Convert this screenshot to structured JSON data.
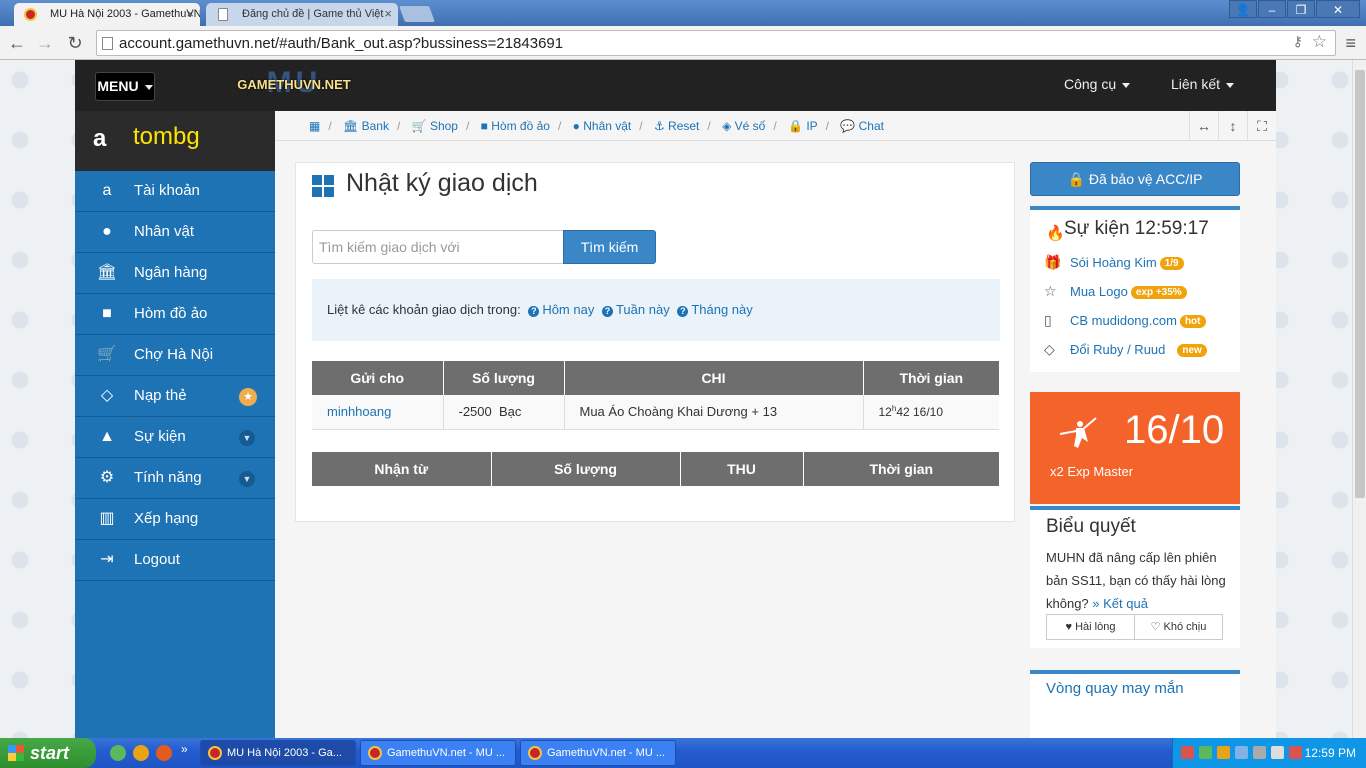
{
  "browser": {
    "tabs": [
      {
        "title": "MU Hà Nội 2003 - GamethuVN",
        "active": true
      },
      {
        "title": "Đăng chủ đề | Game thủ Việt",
        "active": false
      }
    ],
    "url": "account.gamethuvn.net/#auth/Bank_out.asp?bussiness=21843691"
  },
  "topnav": {
    "menu_label": "MENU",
    "logo_text": "GAMETHUVN.NET",
    "logo_watermark": "MU",
    "tools_label": "Công cụ",
    "links_label": "Liên kết"
  },
  "user": {
    "name": "tombg"
  },
  "sidebar": {
    "items": [
      {
        "label": "Tài khoản",
        "icon": "amazon-icon"
      },
      {
        "label": "Nhân vật",
        "icon": "user-icon"
      },
      {
        "label": "Ngân hàng",
        "icon": "bank-icon"
      },
      {
        "label": "Hòm đồ ảo",
        "icon": "briefcase-icon"
      },
      {
        "label": "Chợ Hà Nội",
        "icon": "cart-icon"
      },
      {
        "label": "Nạp thẻ",
        "icon": "diamond-icon"
      },
      {
        "label": "Sự kiện",
        "icon": "android-icon"
      },
      {
        "label": "Tính năng",
        "icon": "cogs-icon"
      },
      {
        "label": "Xếp hạng",
        "icon": "bar-chart-icon"
      },
      {
        "label": "Logout",
        "icon": "sign-out-icon"
      }
    ]
  },
  "breadcrumbs": [
    "Bank",
    "Shop",
    "Hòm đồ ảo",
    "Nhân vật",
    "Reset",
    "Vé số",
    "IP",
    "Chat"
  ],
  "main": {
    "title": "Nhật ký giao dịch",
    "search_placeholder": "Tìm kiếm giao dịch với",
    "search_button": "Tìm kiếm",
    "info_text": "Liệt kê các khoản giao dịch trong:",
    "filters": [
      "Hôm nay",
      "Tuần này",
      "Tháng này"
    ],
    "out_table": {
      "headers": [
        "Gửi cho",
        "Số lượng",
        "CHI",
        "Thời gian"
      ],
      "rows": [
        {
          "to": "minhhoang",
          "amount": "-2500  Bạc",
          "desc": "Mua Áo Choàng Khai Dương + 13",
          "time_hour": "12",
          "time_h": "h",
          "time_rest": "42 16/10"
        }
      ]
    },
    "in_table": {
      "headers": [
        "Nhận từ",
        "Số lượng",
        "THU",
        "Thời gian"
      ]
    }
  },
  "right": {
    "protect_label": "Đã bảo vệ ACC/IP",
    "events_title": "Sự kiện 12:59:17",
    "events": [
      {
        "label": "Sói Hoàng Kim",
        "tag": "1/9",
        "icon": "gift-icon"
      },
      {
        "label": "Mua Logo",
        "tag": "exp +35%",
        "icon": "star-icon"
      },
      {
        "label": "CB mudidong.com",
        "tag": "hot",
        "icon": "mobile-icon"
      },
      {
        "label": "Đổi Ruby / Ruud",
        "tag": "new",
        "icon": "diamond-icon"
      }
    ],
    "promo": {
      "date": "16/10",
      "subtitle": "x2 Exp Master"
    },
    "vote": {
      "title": "Biểu quyết",
      "question": "MUHN đã nâng cấp lên phiên bản SS11, bạn có thấy hài lòng không?",
      "result_link": "Kết quả",
      "yes": "Hài lòng",
      "no": "Khó chịu"
    },
    "lucky": "Vòng quay may mắn"
  },
  "taskbar": {
    "start": "start",
    "tasks": [
      "MU Hà Nội 2003 - Ga...",
      "GamethuVN.net - MU ...",
      "GamethuVN.net - MU ..."
    ],
    "clock": "12:59 PM"
  },
  "colors": {
    "primary": "#1e73b5",
    "accent": "#f4632a",
    "badge": "#f0a30a"
  }
}
